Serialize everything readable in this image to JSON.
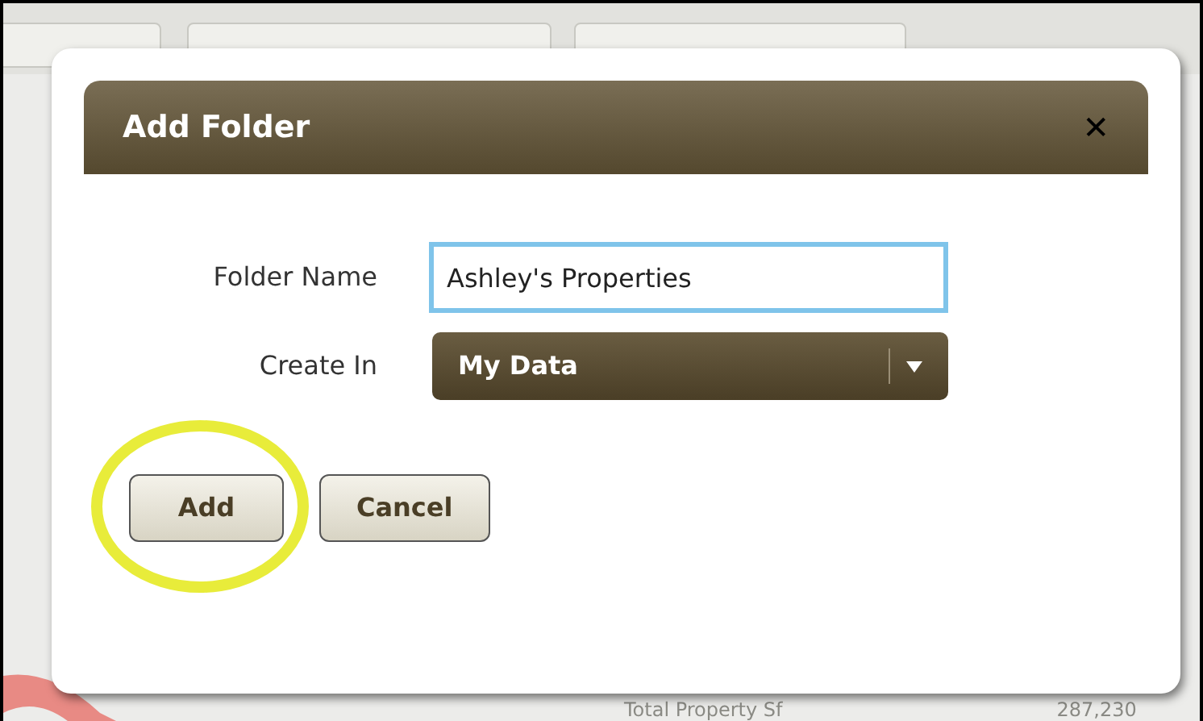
{
  "background": {
    "summary_label": "Total Property Sf",
    "summary_value": "287,230"
  },
  "dialog": {
    "title": "Add Folder",
    "close": "✕",
    "fields": [
      {
        "kind": "text",
        "label": "Folder Name",
        "value": "Ashley's Properties"
      },
      {
        "kind": "select",
        "label": "Create In",
        "value": "My Data"
      }
    ],
    "buttons": [
      {
        "label": "Add",
        "highlighted": true
      },
      {
        "label": "Cancel",
        "highlighted": false
      }
    ]
  }
}
